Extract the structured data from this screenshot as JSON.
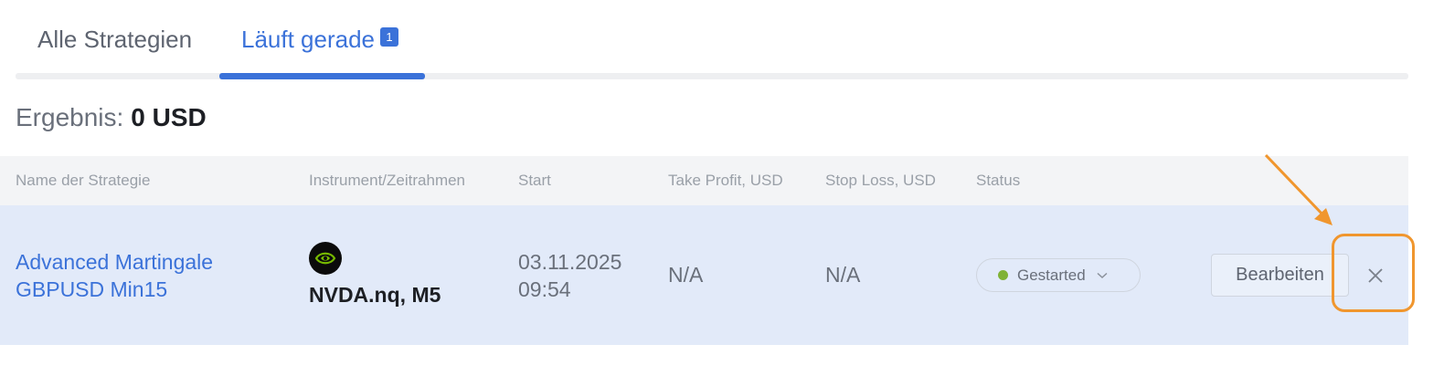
{
  "tabs": {
    "all_label": "Alle Strategien",
    "running_label": "Läuft gerade",
    "running_count": "1",
    "active": "running"
  },
  "result": {
    "label": "Ergebnis:",
    "value": "0 USD"
  },
  "table": {
    "columns": {
      "name": "Name der Strategie",
      "instrument": "Instrument/Zeitrahmen",
      "start": "Start",
      "take_profit": "Take Profit, USD",
      "stop_loss": "Stop Loss, USD",
      "status": "Status"
    },
    "rows": [
      {
        "name_line1": "Advanced Martingale",
        "name_line2": "GBPUSD Min15",
        "instrument_icon": "nvidia-logo-icon",
        "instrument": "NVDA.nq, M5",
        "start_date": "03.11.2025",
        "start_time": "09:54",
        "take_profit": "N/A",
        "stop_loss": "N/A",
        "status": "Gestarted",
        "edit_label": "Bearbeiten"
      }
    ]
  },
  "colors": {
    "accent": "#3b72d9",
    "row_highlight": "#e2eaf9",
    "status_dot": "#7fb236",
    "annotation": "#f0962e"
  }
}
